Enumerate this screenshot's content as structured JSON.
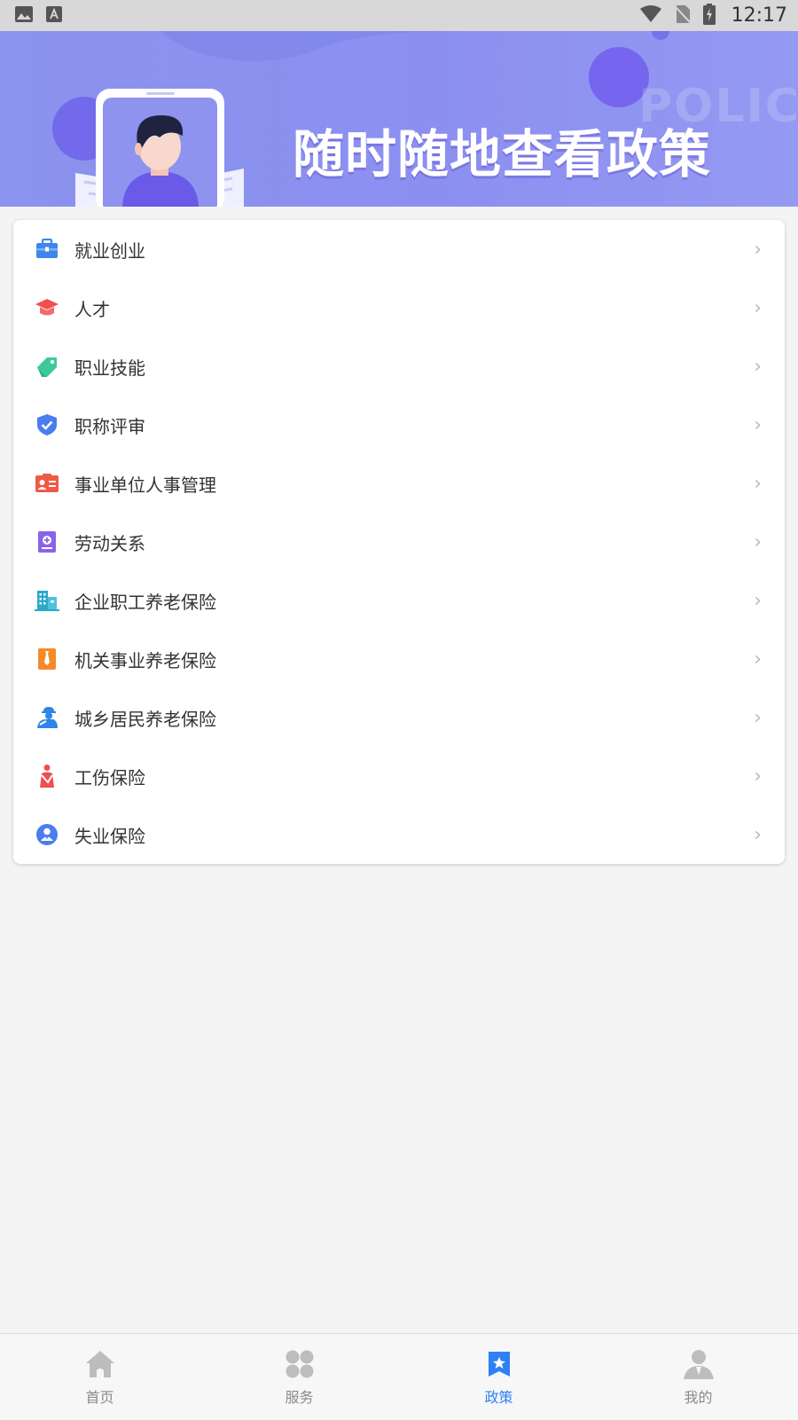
{
  "status_bar": {
    "time": "12:17"
  },
  "banner": {
    "title": "随时随地查看政策",
    "watermark": "POLICY"
  },
  "menu": {
    "items": [
      {
        "label": "就业创业",
        "icon": "briefcase-icon"
      },
      {
        "label": "人才",
        "icon": "graduation-cap-icon"
      },
      {
        "label": "职业技能",
        "icon": "tag-icon"
      },
      {
        "label": "职称评审",
        "icon": "shield-check-icon"
      },
      {
        "label": "事业单位人事管理",
        "icon": "id-card-icon"
      },
      {
        "label": "劳动关系",
        "icon": "contract-book-icon"
      },
      {
        "label": "企业职工养老保险",
        "icon": "office-building-icon"
      },
      {
        "label": "机关事业养老保险",
        "icon": "tie-icon"
      },
      {
        "label": "城乡居民养老保险",
        "icon": "worker-icon"
      },
      {
        "label": "工伤保险",
        "icon": "injured-person-icon"
      },
      {
        "label": "失业保险",
        "icon": "person-circle-icon"
      }
    ],
    "chevron": "›"
  },
  "tabs": [
    {
      "label": "首页",
      "icon": "home-icon",
      "active": false
    },
    {
      "label": "服务",
      "icon": "grid-icon",
      "active": false
    },
    {
      "label": "政策",
      "icon": "bookmark-star-icon",
      "active": true
    },
    {
      "label": "我的",
      "icon": "user-icon",
      "active": false
    }
  ],
  "colors": {
    "accent": "#2f7ff5",
    "banner": "#8a93ee",
    "inactive_tab": "#8a8a8a"
  }
}
